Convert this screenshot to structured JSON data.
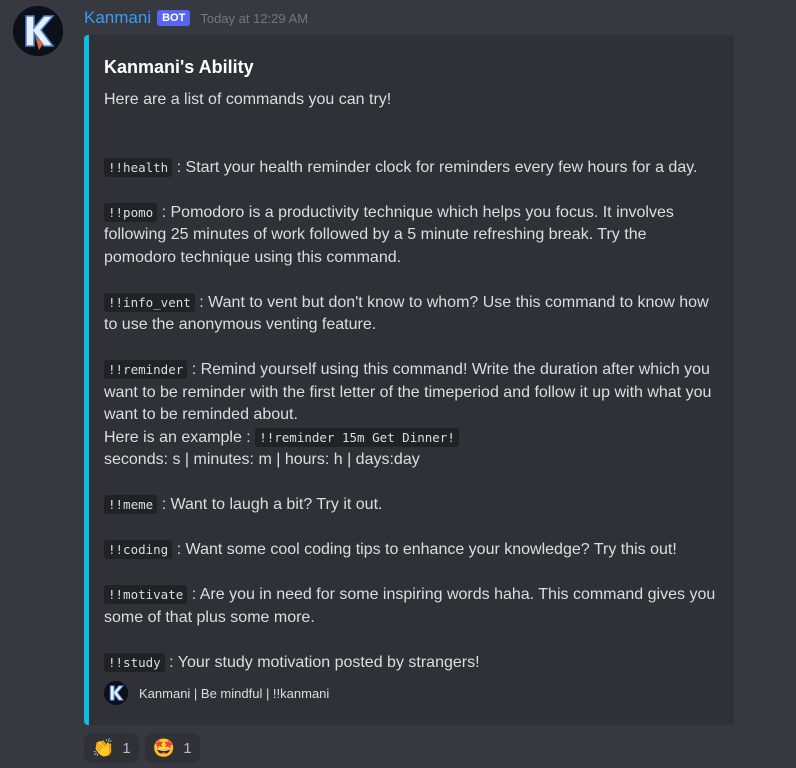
{
  "message": {
    "author": "Kanmani",
    "bot_badge": "BOT",
    "timestamp": "Today at 12:29 AM"
  },
  "embed": {
    "title": "Kanmani's Ability",
    "intro": "Here are a list of commands you can try!",
    "commands": [
      {
        "cmd": "!!health",
        "text": " : Start your health reminder clock for reminders every few hours for a day."
      },
      {
        "cmd": "!!pomo",
        "text": " : Pomodoro is a productivity technique which helps you focus. It involves following 25 minutes of work followed by a 5 minute refreshing break. Try the pomodoro technique using this command."
      },
      {
        "cmd": "!!info_vent",
        "text": " : Want to vent but don't know to whom? Use this command to know how to use the anonymous venting feature."
      },
      {
        "cmd": "!!reminder",
        "text": " : Remind yourself using this command! Write the duration after which you want to be reminder with the first letter of the timeperiod and follow it up with what you want to be reminded about.",
        "example_label": "Here is an example : ",
        "example_code": "!!reminder 15m Get Dinner!",
        "units": "seconds: s | minutes: m | hours: h | days:day"
      },
      {
        "cmd": "!!meme",
        "text": " : Want to laugh a bit? Try it out."
      },
      {
        "cmd": "!!coding",
        "text": " : Want some cool coding tips to enhance your knowledge? Try this out!"
      },
      {
        "cmd": "!!motivate",
        "text": " : Are you in need for some inspiring words haha. This command gives you some of that plus some more."
      },
      {
        "cmd": "!!study",
        "text": " : Your study motivation posted by strangers!"
      }
    ],
    "footer": "Kanmani | Be mindful | !!kanmani",
    "accent_color": "#0fbbe8"
  },
  "reactions": [
    {
      "emoji": "👏",
      "count": "1",
      "icon": "clapping-hands-icon"
    },
    {
      "emoji": "🤩",
      "count": "1",
      "icon": "star-struck-icon"
    }
  ]
}
